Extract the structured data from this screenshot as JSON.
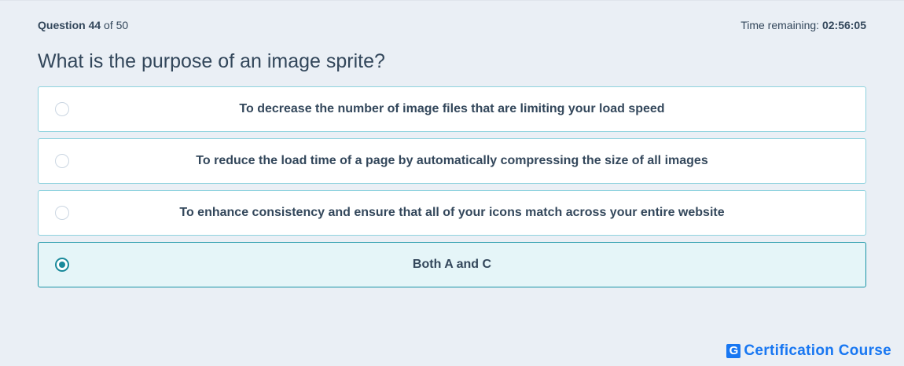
{
  "header": {
    "question_label": "Question",
    "question_number": "44",
    "question_of": "of 50",
    "time_label": "Time remaining:",
    "time_value": "02:56:05"
  },
  "question": {
    "text": "What is the purpose of an image sprite?"
  },
  "options": [
    {
      "label": "To decrease the number of image files that are limiting your load speed",
      "selected": false
    },
    {
      "label": "To reduce the load time of a page by automatically compressing the size of all images",
      "selected": false
    },
    {
      "label": "To enhance consistency and ensure that all of your icons match across your entire website",
      "selected": false
    },
    {
      "label": "Both A and C",
      "selected": true
    }
  ],
  "brand": {
    "mark": "G",
    "name": "Certification Course",
    "color": "#1877f2"
  },
  "colors": {
    "accent": "#1a8a9b",
    "option_border": "#8ed2de",
    "selected_bg": "#e5f5f8",
    "background": "#eaeff5"
  }
}
